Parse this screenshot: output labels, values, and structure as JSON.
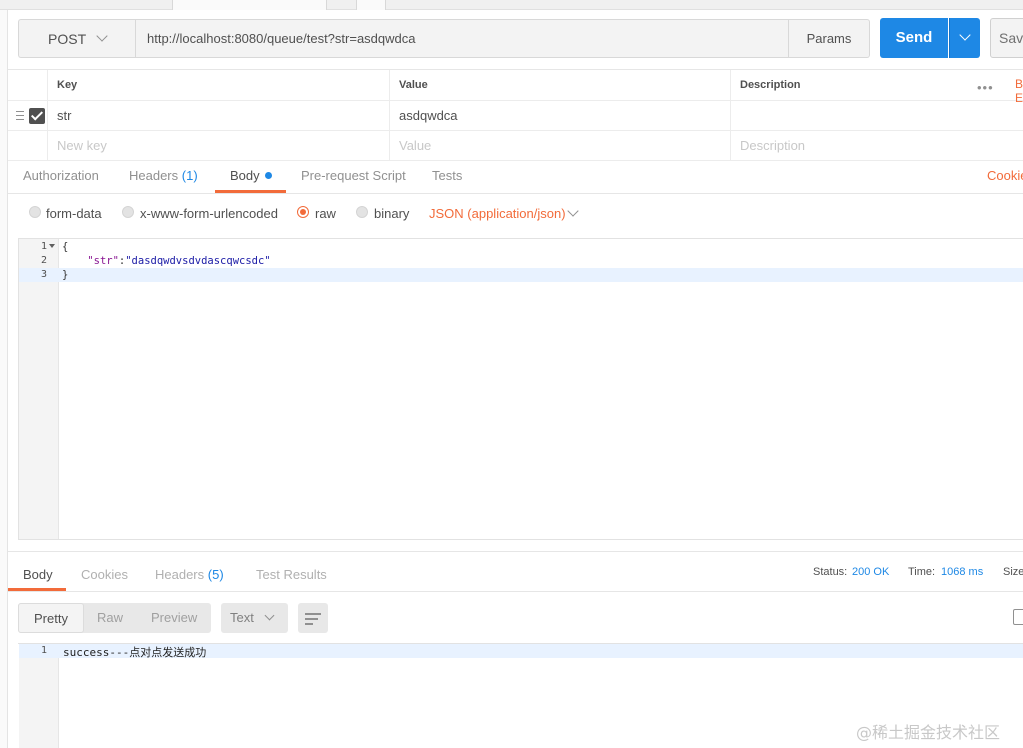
{
  "request": {
    "method": "POST",
    "url": "http://localhost:8080/queue/test?str=asdqwdca",
    "params_label": "Params",
    "send_label": "Send",
    "save_label": "Save"
  },
  "params_table": {
    "headers": {
      "key": "Key",
      "value": "Value",
      "description": "Description"
    },
    "rows": [
      {
        "key": "str",
        "value": "asdqwdca",
        "description": ""
      }
    ],
    "placeholders": {
      "key": "New key",
      "value": "Value",
      "description": "Description"
    },
    "bulk_edit": "Bulk Edit"
  },
  "request_tabs": {
    "authorization": "Authorization",
    "headers": "Headers",
    "headers_count": "(1)",
    "body": "Body",
    "prerequest": "Pre-request Script",
    "tests": "Tests",
    "cookies": "Cookies",
    "active": "Body"
  },
  "body_modes": {
    "form_data": "form-data",
    "urlencoded": "x-www-form-urlencoded",
    "raw": "raw",
    "binary": "binary",
    "selected": "raw",
    "content_type": "JSON (application/json)"
  },
  "request_body": {
    "line_numbers": [
      "1",
      "2",
      "3"
    ],
    "lines": [
      "{",
      "    \"str\":\"dasdqwdvsdvdascqwcsdc\"",
      "}"
    ],
    "key": "\"str\"",
    "value": "\"dasdqwdvsdvdascqwcsdc\""
  },
  "response": {
    "tabs": {
      "body": "Body",
      "cookies": "Cookies",
      "headers": "Headers",
      "headers_count": "(5)",
      "test_results": "Test Results",
      "active": "Body"
    },
    "status_label": "Status:",
    "status_value": "200 OK",
    "time_label": "Time:",
    "time_value": "1068 ms",
    "size_label": "Size",
    "view_modes": {
      "pretty": "Pretty",
      "raw": "Raw",
      "preview": "Preview",
      "selected": "Pretty"
    },
    "format": "Text",
    "line_numbers": [
      "1"
    ],
    "body_text": "success---点对点发送成功"
  },
  "watermark": "@稀土掘金技术社区",
  "colors": {
    "accent": "#f26b3a",
    "primary": "#1e88e5"
  }
}
